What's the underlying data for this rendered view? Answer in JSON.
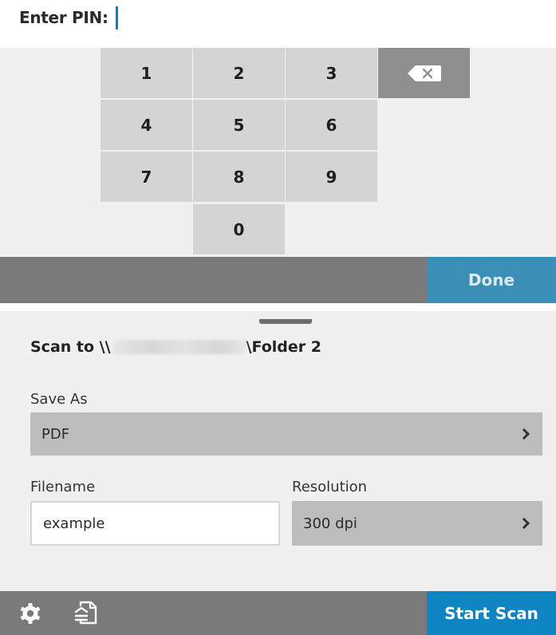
{
  "pin": {
    "label": "Enter PIN:",
    "value": ""
  },
  "keypad": {
    "keys": [
      "1",
      "2",
      "3",
      "4",
      "5",
      "6",
      "7",
      "8",
      "9",
      "0"
    ],
    "backspace_icon": "backspace-icon"
  },
  "done_bar": {
    "done_label": "Done"
  },
  "scan": {
    "title_prefix": "Scan to \\\\",
    "title_suffix": "\\Folder 2",
    "save_as": {
      "label": "Save As",
      "value": "PDF"
    },
    "filename": {
      "label": "Filename",
      "value": "example"
    },
    "resolution": {
      "label": "Resolution",
      "value": "300 dpi"
    }
  },
  "bottom_bar": {
    "settings_icon": "gear-icon",
    "document_icon": "document-scan-icon",
    "start_label": "Start Scan"
  },
  "colors": {
    "accent": "#0e84c2",
    "done_button": "#3b8fb6",
    "bar": "#7a7a7a",
    "key": "#d4d4d4",
    "caret": "#0f7fc0"
  }
}
